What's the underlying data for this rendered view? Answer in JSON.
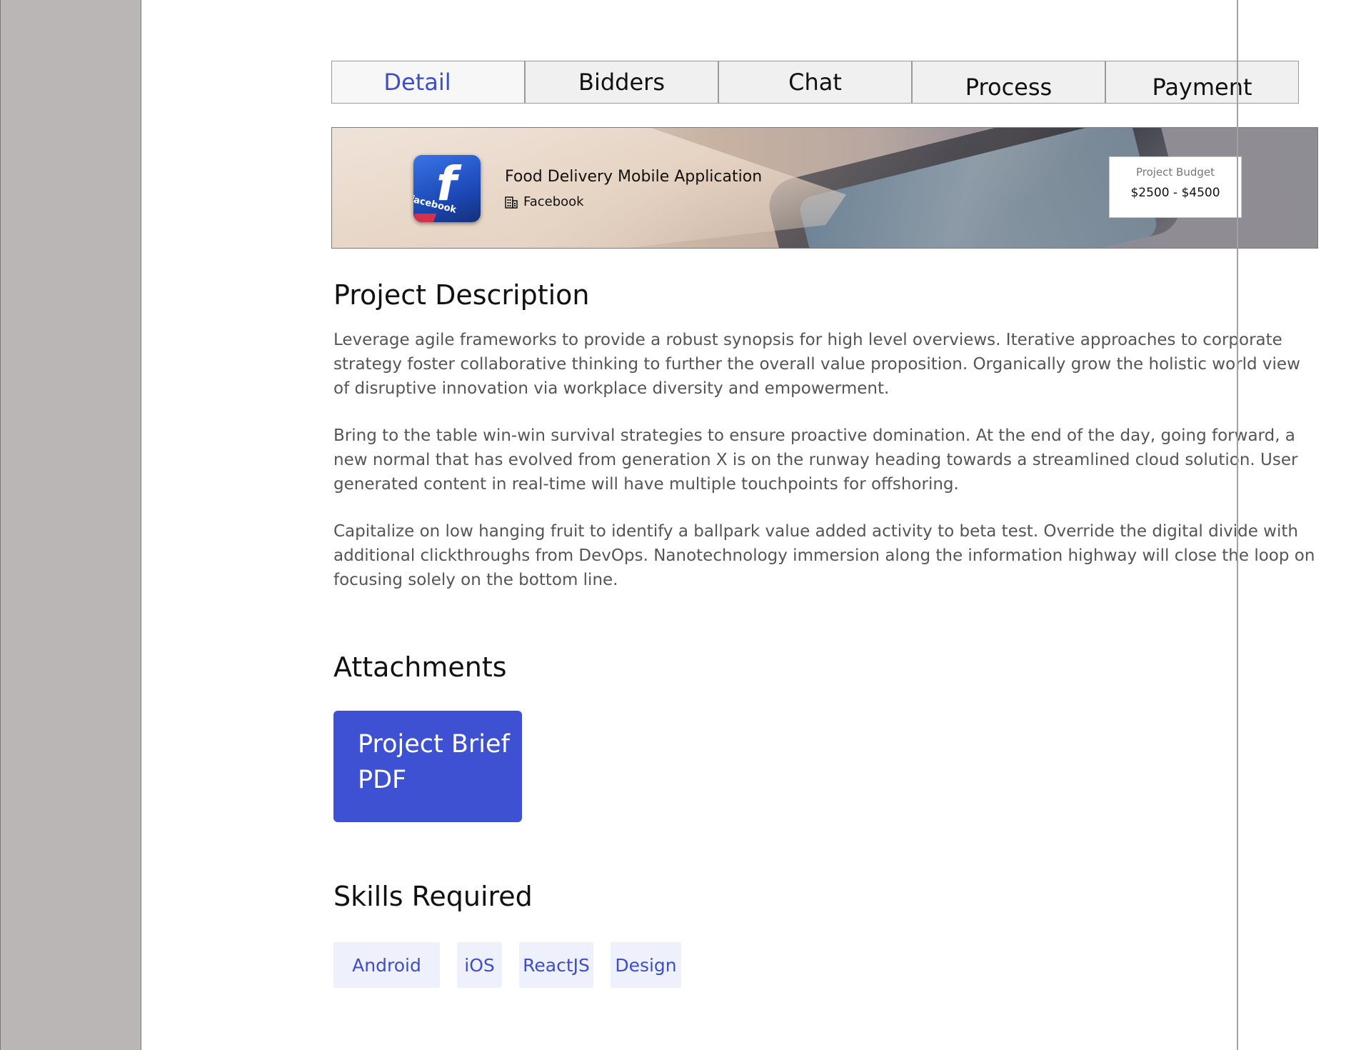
{
  "tabs": [
    {
      "label": "Detail",
      "active": true
    },
    {
      "label": "Bidders",
      "active": false
    },
    {
      "label": "Chat",
      "active": false
    },
    {
      "label": "Process",
      "active": false
    },
    {
      "label": "Payment",
      "active": false
    }
  ],
  "banner": {
    "project_title": "Food Delivery Mobile Application",
    "company": "Facebook",
    "logo_icon": "facebook-logo",
    "logo_text": "facebook",
    "budget_label": "Project Budget",
    "budget_value": "$2500 - $4500"
  },
  "description": {
    "title": "Project Description",
    "paragraphs": [
      "Leverage agile frameworks to provide a robust synopsis for high level overviews. Iterative approaches to corporate strategy foster collaborative thinking to further the overall value proposition. Organically grow the holistic world view of disruptive innovation via workplace diversity and empowerment.",
      "Bring to the table win-win survival strategies to ensure proactive domination. At the end of the day, going forward, a new normal that has evolved from generation X is on the runway heading towards a streamlined cloud solution. User generated content in real-time will have multiple touchpoints for offshoring.",
      "Capitalize on low hanging fruit to identify a ballpark value added activity to beta test. Override the digital divide with additional clickthroughs from DevOps. Nanotechnology immersion along the information highway will close the loop on focusing solely on the bottom line."
    ]
  },
  "attachments": {
    "title": "Attachments",
    "items": [
      {
        "line1": "Project Brief",
        "line2": "PDF"
      }
    ]
  },
  "skills": {
    "title": "Skills Required",
    "items": [
      "Android",
      "iOS",
      "ReactJS",
      "Design"
    ]
  },
  "colors": {
    "accent": "#3e51d2",
    "sidebar": "#bbb6b6",
    "skill_bg": "#eef0fb"
  }
}
